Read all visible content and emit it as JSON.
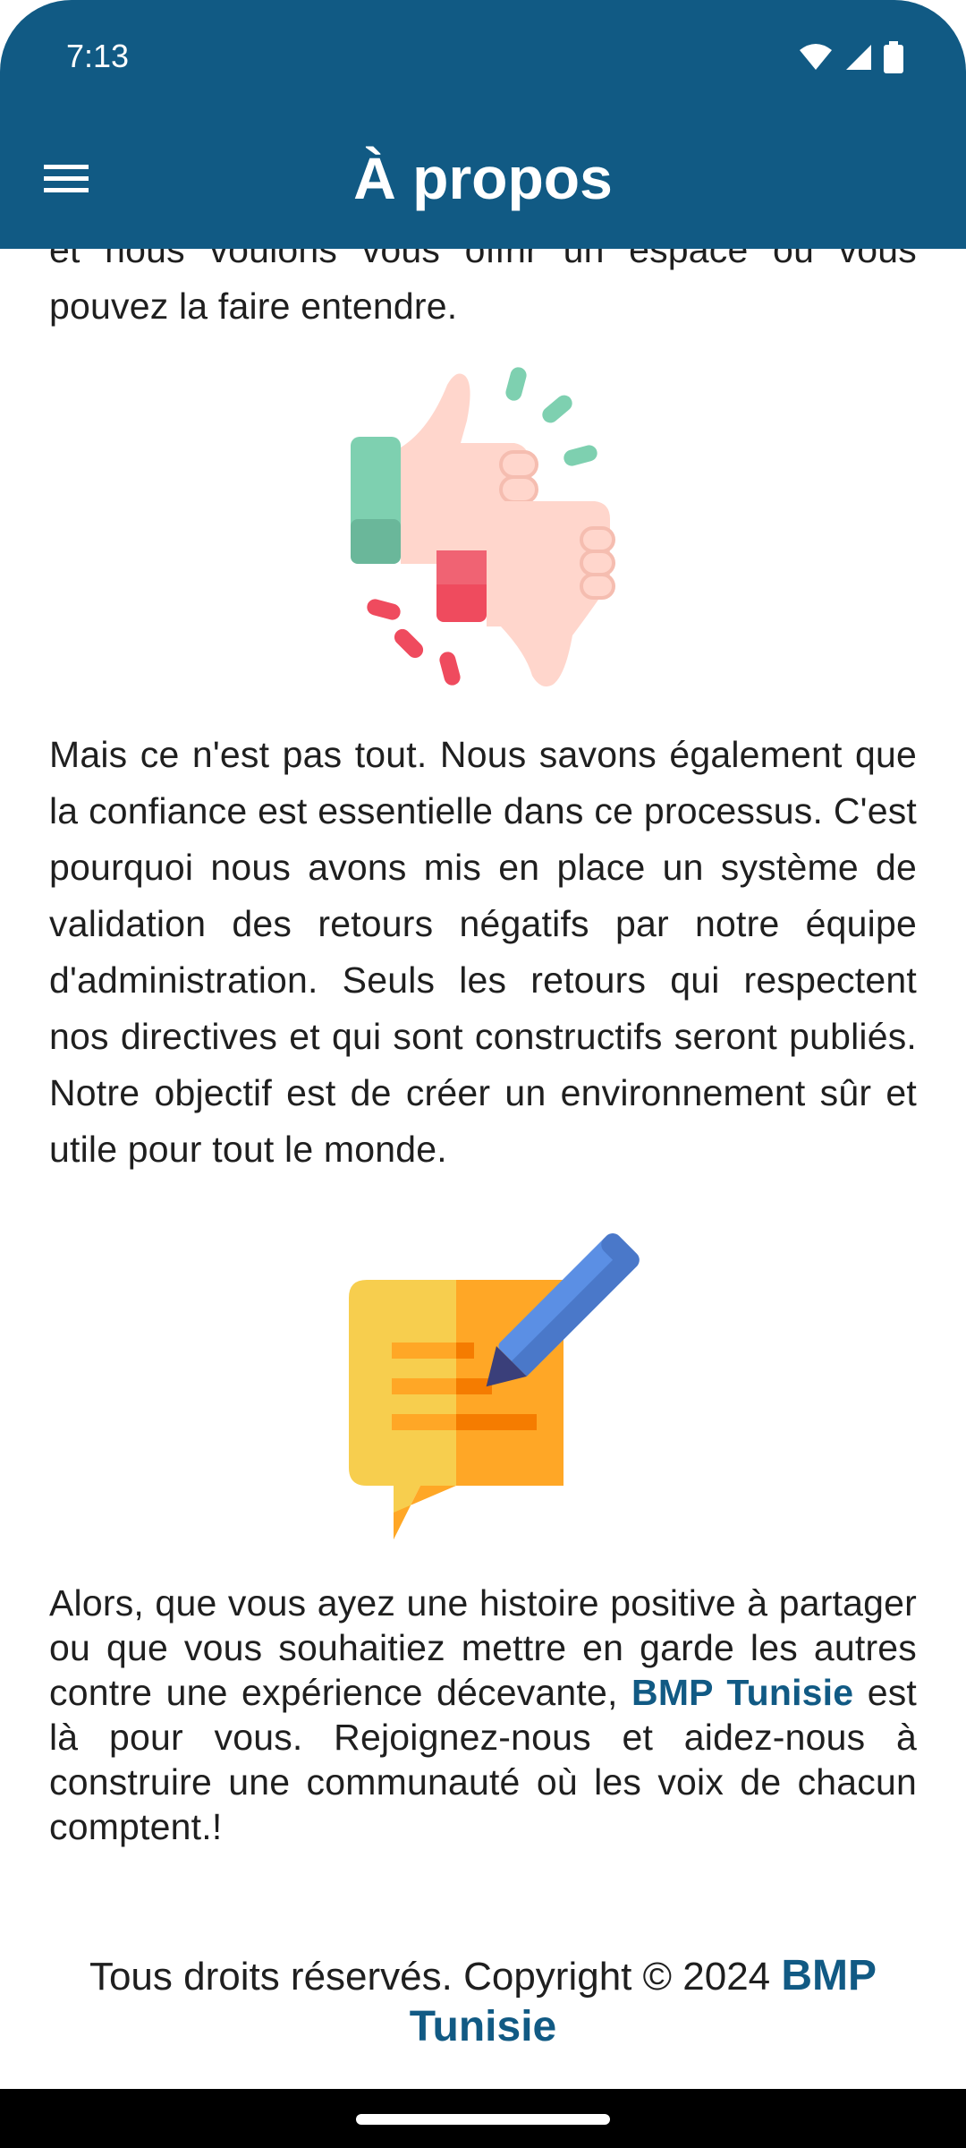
{
  "status_bar": {
    "time": "7:13",
    "icons": [
      "wifi-icon",
      "signal-icon",
      "battery-icon"
    ]
  },
  "app_bar": {
    "title": "À propos",
    "menu_icon": "menu-icon",
    "color": "#115A84"
  },
  "content": {
    "para_top": "et nous voulons vous offrir un espace où vous pouvez la faire entendre.",
    "illustration_1": "thumbs-up-down-icon",
    "para_middle": "Mais ce n'est pas tout. Nous savons également que la confiance est essentielle dans ce processus. C'est pourquoi nous avons mis en place un système de validation des retours négatifs par notre équipe d'administration. Seuls les retours qui respectent nos directives et qui sont constructifs seront publiés. Notre objectif est de créer un environnement sûr et utile pour tout le monde.",
    "illustration_2": "write-feedback-icon",
    "para_bottom_start": "Alors, que vous ayez une histoire positive à partager ou que vous souhaitiez mettre en garde les autres contre une expérience décevante, ",
    "para_bottom_brand": "BMP Tunisie",
    "para_bottom_end": " est là pour vous. Rejoignez-nous et aidez-nous à construire une communauté où les voix de chacun comptent.!"
  },
  "footer": {
    "text": "Tous droits réservés. Copyright © 2024 ",
    "brand": "BMP Tunisie"
  }
}
